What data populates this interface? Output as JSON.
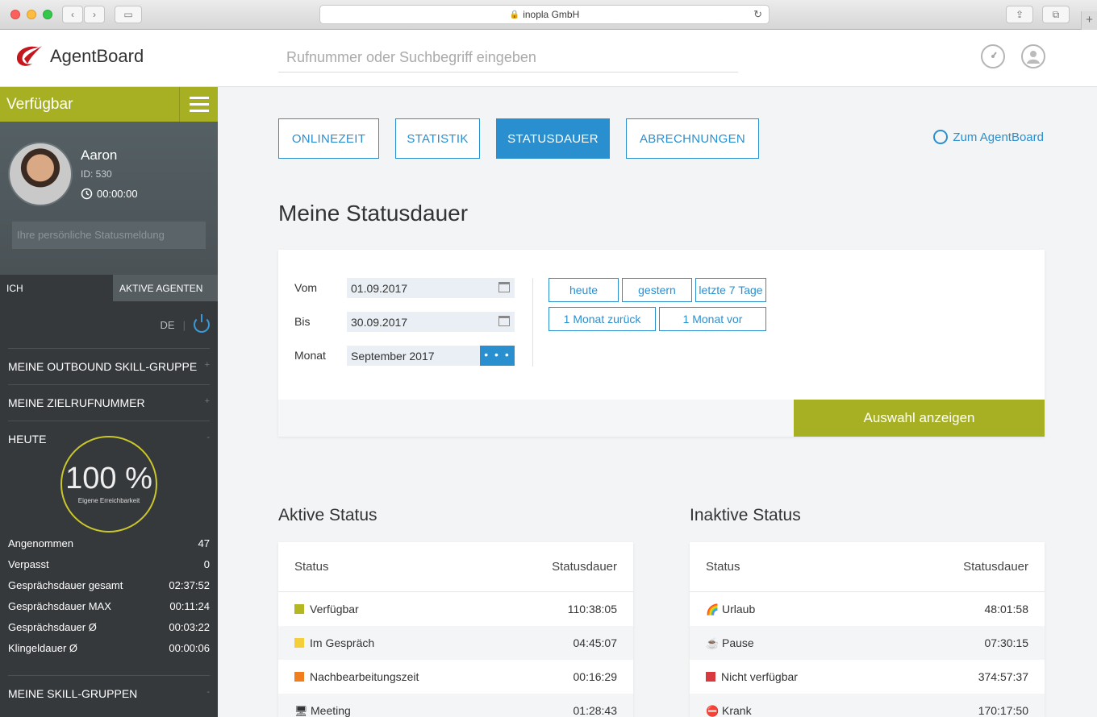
{
  "browser": {
    "url": "inopla GmbH"
  },
  "header": {
    "app_name": "AgentBoard",
    "search_placeholder": "Rufnummer oder Suchbegriff eingeben"
  },
  "sidebar": {
    "status": "Verfügbar",
    "user": {
      "name": "Aaron",
      "id": "ID: 530",
      "timer": "00:00:00"
    },
    "status_message_placeholder": "Ihre persönliche Statusmeldung",
    "tabs": [
      "ICH",
      "AKTIVE AGENTEN"
    ],
    "language": "DE",
    "sections": {
      "outbound": "MEINE OUTBOUND SKILL-GRUPPE",
      "target": "MEINE ZIELRUFNUMMER",
      "today": "HEUTE",
      "skill_groups": "MEINE SKILL-GRUPPEN"
    },
    "gauge": {
      "value": "100 %",
      "label": "Eigene Erreichbarkeit"
    },
    "stats": [
      {
        "label": "Angenommen",
        "value": "47"
      },
      {
        "label": "Verpasst",
        "value": "0"
      },
      {
        "label": "Gesprächsdauer gesamt",
        "value": "02:37:52"
      },
      {
        "label": "Gesprächsdauer MAX",
        "value": "00:11:24"
      },
      {
        "label": "Gesprächsdauer Ø",
        "value": "00:03:22"
      },
      {
        "label": "Klingeldauer Ø",
        "value": "00:00:06"
      }
    ]
  },
  "nav": {
    "tabs": [
      "ONLINEZEIT",
      "STATISTIK",
      "STATUSDAUER",
      "ABRECHNUNGEN"
    ],
    "active": "STATUSDAUER",
    "back_link": "Zum AgentBoard"
  },
  "page_title": "Meine Statusdauer",
  "filter": {
    "from_label": "Vom",
    "from_value": "01.09.2017",
    "to_label": "Bis",
    "to_value": "30.09.2017",
    "month_label": "Monat",
    "month_value": "September 2017",
    "month_more": "• • •",
    "quick": [
      "heute",
      "gestern",
      "letzte 7 Tage",
      "1 Monat zurück",
      "1 Monat vor"
    ],
    "submit": "Auswahl anzeigen"
  },
  "active_status": {
    "title": "Aktive Status",
    "col_status": "Status",
    "col_duration": "Statusdauer",
    "rows": [
      {
        "label": "Verfügbar",
        "value": "110:38:05",
        "color": "#b4b622",
        "icon": "square"
      },
      {
        "label": "Im Gespräch",
        "value": "04:45:07",
        "color": "#f5cf3a",
        "icon": "square"
      },
      {
        "label": "Nachbearbeitungszeit",
        "value": "00:16:29",
        "color": "#f07d1e",
        "icon": "square"
      },
      {
        "label": "Meeting",
        "value": "01:28:43",
        "color": "#4a7fb5",
        "icon": "monitor-icon"
      }
    ]
  },
  "inactive_status": {
    "title": "Inaktive Status",
    "col_status": "Status",
    "col_duration": "Statusdauer",
    "rows": [
      {
        "label": "Urlaub",
        "value": "48:01:58",
        "icon": "rainbow-icon"
      },
      {
        "label": "Pause",
        "value": "07:30:15",
        "icon": "coffee-icon"
      },
      {
        "label": "Nicht verfügbar",
        "value": "374:57:37",
        "color": "#d9383f",
        "icon": "square"
      },
      {
        "label": "Krank",
        "value": "170:17:50",
        "icon": "no-entry-icon"
      }
    ]
  }
}
